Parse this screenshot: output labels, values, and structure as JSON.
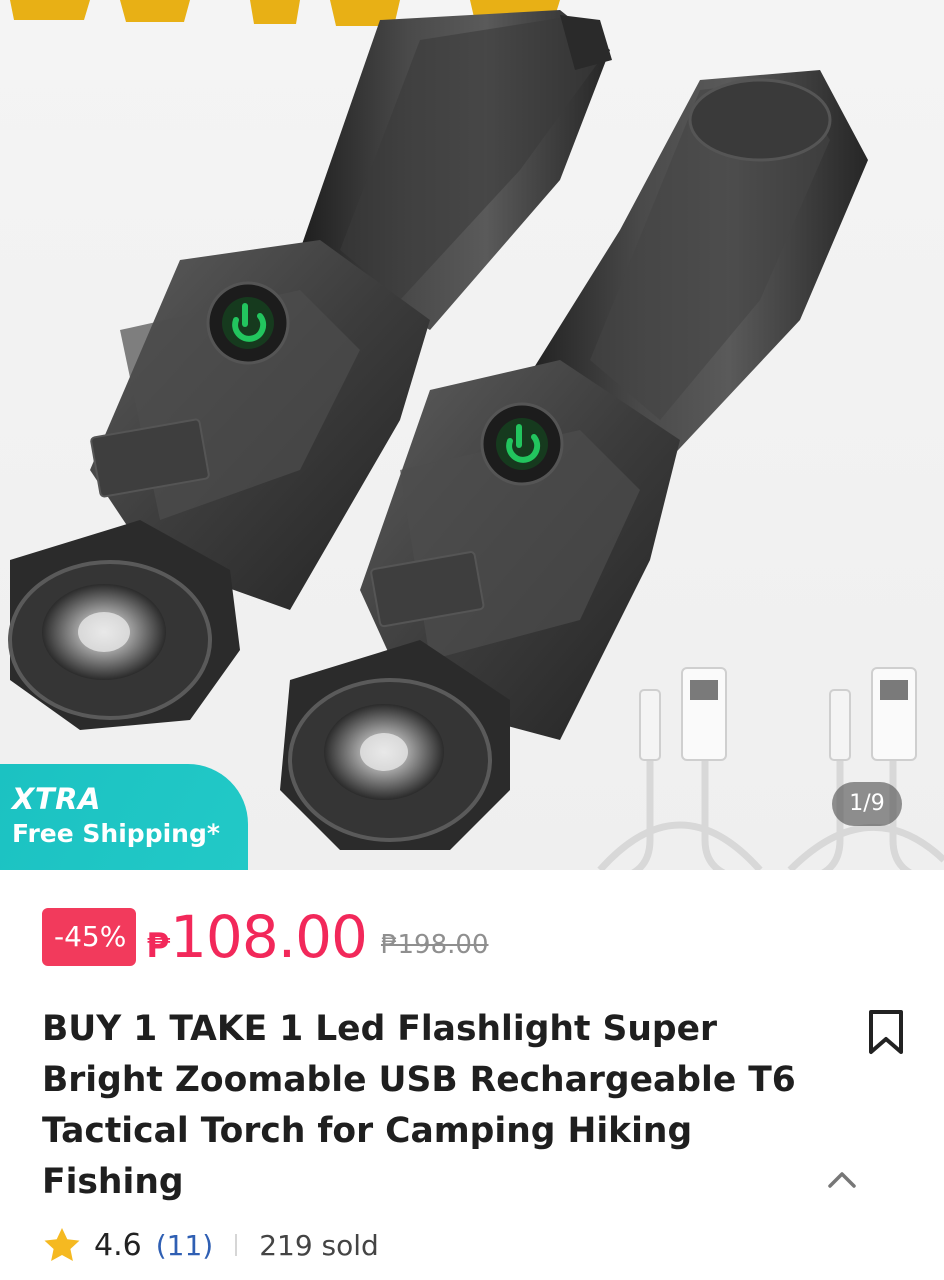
{
  "gallery": {
    "badge_title": "XTRA",
    "badge_subtitle": "Free Shipping*",
    "page_indicator": "1/9",
    "colors": {
      "badge": "#1bc2c2",
      "flashlight_body": "#3a3a3a",
      "power_button": "#22c55e"
    }
  },
  "price": {
    "discount": "-45%",
    "currency": "₱",
    "current": "108.00",
    "original": "₱198.00",
    "colors": {
      "accent": "#f2285a",
      "discount_bg": "#f23a5c"
    }
  },
  "product": {
    "title": "BUY 1 TAKE 1 Led Flashlight Super Bright Zoomable USB Rechargeable T6 Tactical Torch for Camping Hiking Fishing",
    "bookmark_icon": "bookmark-icon",
    "collapse_icon": "chevron-up-icon"
  },
  "rating": {
    "star_icon": "star-icon",
    "value": "4.6",
    "count": "(11)",
    "sold": "219 sold",
    "colors": {
      "star": "#f5b921",
      "count_link": "#2f5fb3"
    }
  }
}
